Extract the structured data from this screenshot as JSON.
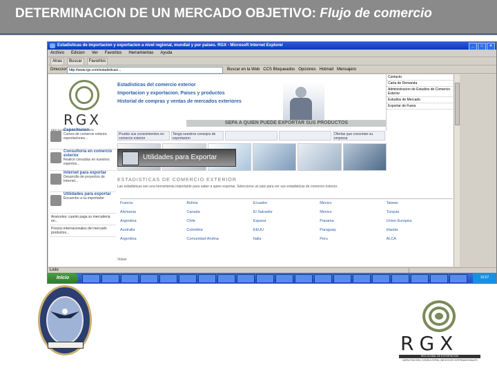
{
  "slide": {
    "title_main": "DETERMINACION DE UN MERCADO OBJETIVO:",
    "title_sub": "Flujo de comercio"
  },
  "browser": {
    "title": "Estadisticas de importacion y exportacion a nivel regional, mundial y por paises. RGX - Microsoft Internet Explorer",
    "menu": [
      "Archivo",
      "Edicion",
      "Ver",
      "Favoritos",
      "Herramientas",
      "Ayuda"
    ],
    "toolbar": [
      "Atras",
      "Buscar",
      "Favoritos"
    ],
    "address_label": "Direccion",
    "address_value": "http://www.rgx.com/estadisticas/...",
    "links": [
      "Buscar en la Web",
      "CCS Bloqueados",
      "Opciones",
      "Hotmail",
      "Mensajero"
    ],
    "status": "Listo",
    "start_label": "Inicio",
    "tray_time": "10:07"
  },
  "site": {
    "logo_text": "RGX",
    "logo_tagline": "RED GLOBAL DE EXPORTACION",
    "nav": [
      "Estadisticas del comercio exterior",
      "Importacion y exportacion. Paises y productos",
      "Historial de compras y ventas de mercados exteriores"
    ],
    "slogan": "SEPA A QUIEN PUEDE EXPORTAR SUS PRODUCTOS",
    "right_panel": [
      "Contacto",
      "Carta de Demanda",
      "Administracion de Estudios de Comercio Exterior",
      "Estudios de Mercado",
      "Exportar de Fuera"
    ],
    "left_blocks": [
      {
        "title": "Capacitacion",
        "desc": "Cursos de comercio exterior, exportaciones..."
      },
      {
        "title": "Consultoria en comercio exterior",
        "desc": "Realice consultas en nuestros expertos..."
      },
      {
        "title": "Internet para exportar",
        "desc": "Desarrollo de proyectos de Internet..."
      },
      {
        "title": "Utilidades para exportar",
        "desc": "Encuentre a su importador"
      }
    ],
    "left_plain": [
      "Aranceles: cuanto paga su mercaderia en...",
      "Precios internacionales del mercado productos..."
    ],
    "promos": [
      "Pruebe sus conocimientos en comercio exterior",
      "Tenga nuestros consejos de exportacion",
      "",
      "",
      "Ofertas que concretan su empresa"
    ],
    "utilidades": "Utilidades para Exportar",
    "section_title": "ESTADISTICAS DE COMERCIO EXTERIOR",
    "intro": "Las estadisticas son una herramienta importante para saber a quien exportar. Seleccione un pais para ver sus estadisticas de comercio exterior.",
    "countries": [
      "Francia",
      "Bolivia",
      "Ecuador",
      "Mexico",
      "Taiwan",
      "Alemania",
      "Canada",
      "El Salvador",
      "Mexico",
      "Turquia",
      "Argentina",
      "Chile",
      "Espana",
      "Panama",
      "Union Europea",
      "Australia",
      "Colombia",
      "EEUU",
      "Paraguay",
      "Irlanda",
      "Argentina",
      "Comunidad Andina",
      "Italia",
      "Peru",
      "ALCA"
    ],
    "footer": "Volver"
  },
  "brand": {
    "rgx_word": "RGX",
    "rgx_bar": "RED GLOBAL DE EXPORTACION",
    "rgx_sub": "CAPACITACION | CONSULTORIA | NEGOCIOS INTERNACIONALES"
  }
}
